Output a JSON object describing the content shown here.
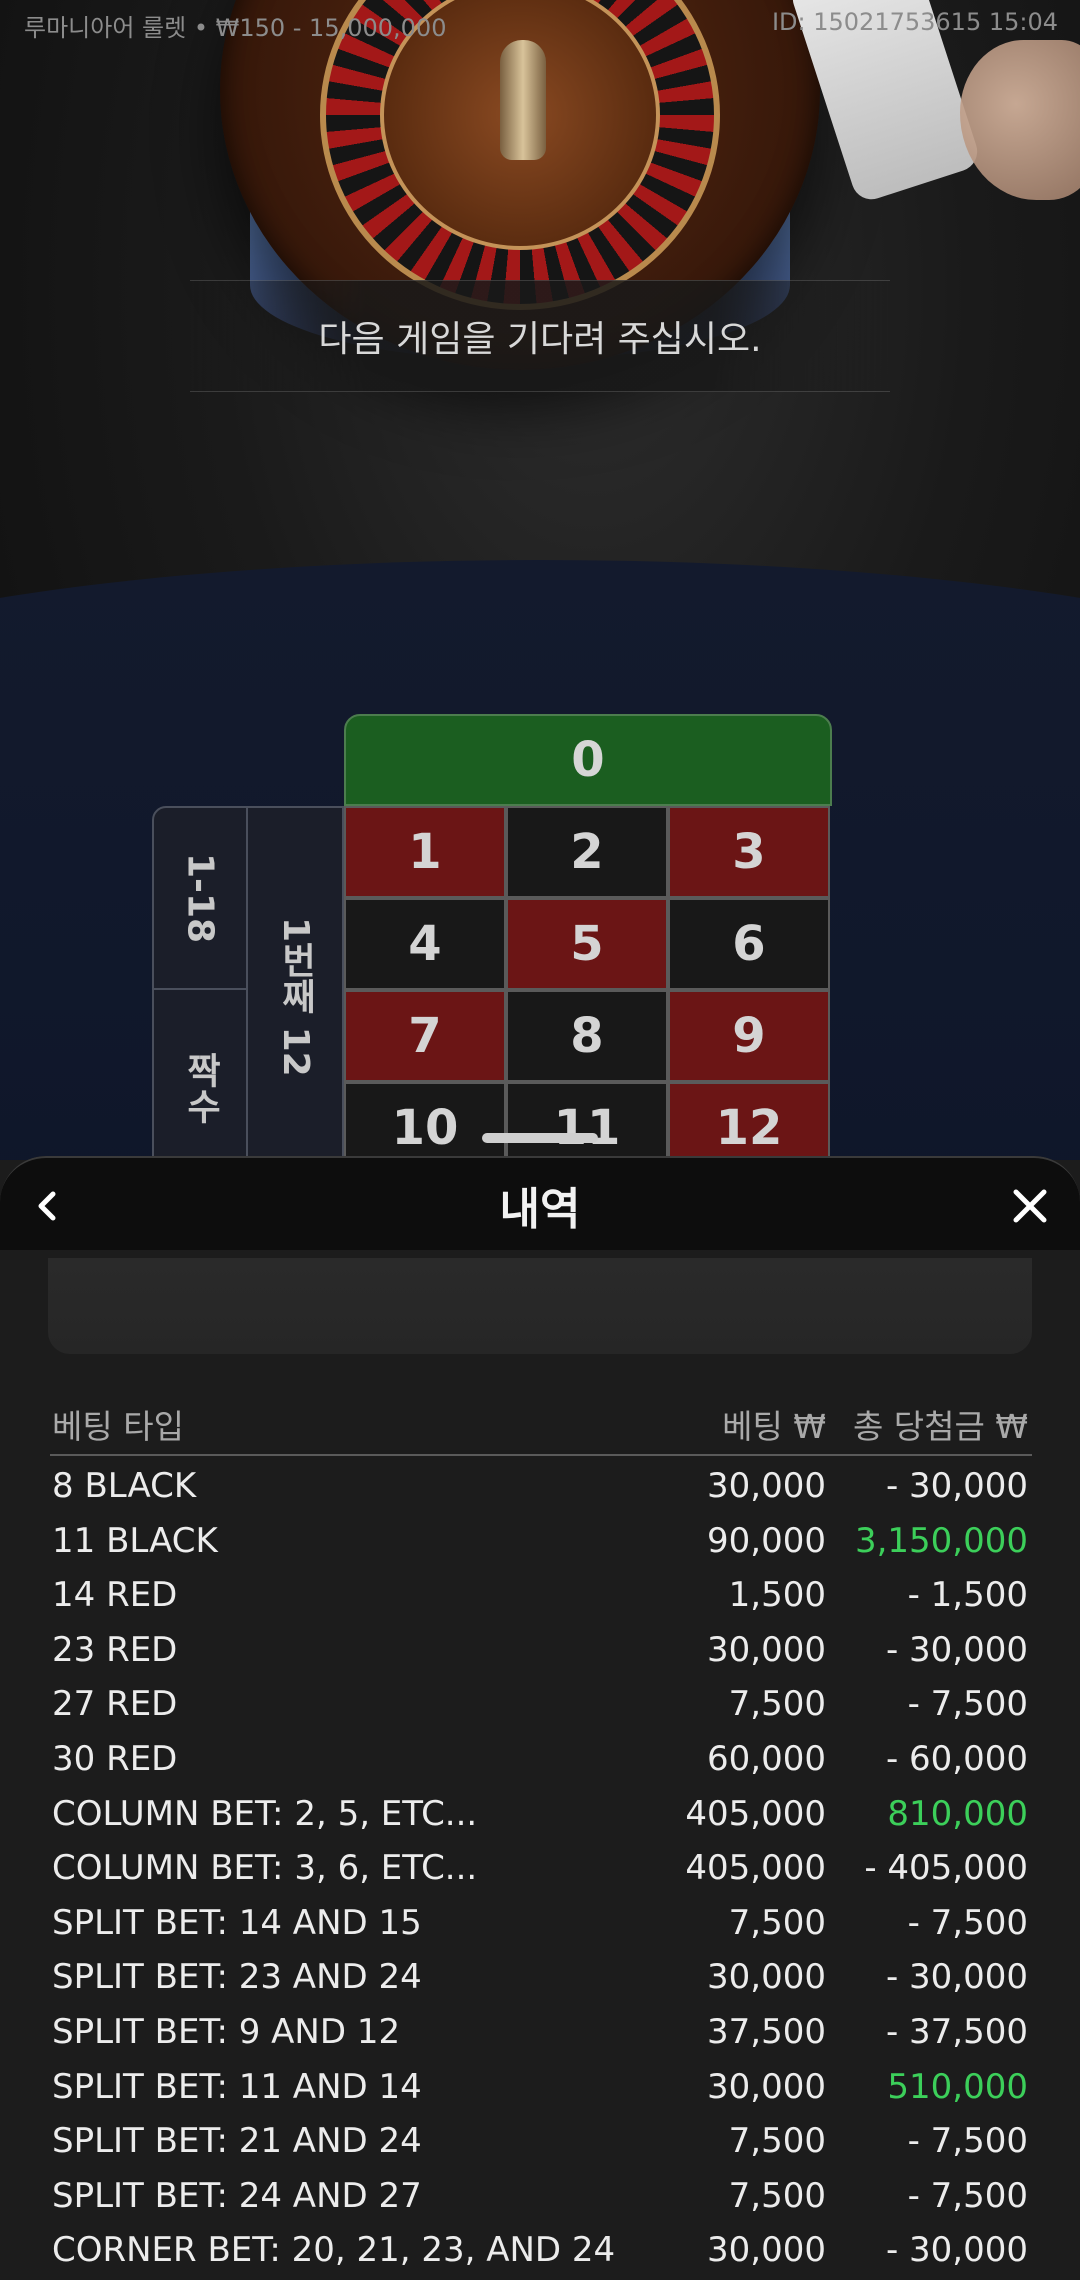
{
  "header": {
    "table_info": "루마니아어 룰렛 • ₩150 - 15,000,000",
    "game_id": "ID: 15021753615 15:04"
  },
  "status_banner": "다음 게임을 기다려 주십시오.",
  "bet_grid": {
    "zero": "0",
    "side_outer": [
      "1-18",
      "짝수"
    ],
    "side_inner": "1번째 12",
    "numbers": [
      {
        "n": "1",
        "color": "red"
      },
      {
        "n": "2",
        "color": "black"
      },
      {
        "n": "3",
        "color": "red"
      },
      {
        "n": "4",
        "color": "black"
      },
      {
        "n": "5",
        "color": "red"
      },
      {
        "n": "6",
        "color": "black"
      },
      {
        "n": "7",
        "color": "red"
      },
      {
        "n": "8",
        "color": "black"
      },
      {
        "n": "9",
        "color": "red"
      },
      {
        "n": "10",
        "color": "black"
      },
      {
        "n": "11",
        "color": "black"
      },
      {
        "n": "12",
        "color": "red"
      }
    ]
  },
  "panel": {
    "title": "내역",
    "back_icon": "chevron-left-icon",
    "close_icon": "close-icon",
    "columns": {
      "bet_type": "베팅 타입",
      "bet": "베팅 ₩",
      "total_win": "총 당첨금 ₩"
    },
    "rows": [
      {
        "type": "8 BLACK",
        "bet": "30,000",
        "win": "- 30,000",
        "positive": false
      },
      {
        "type": "11 BLACK",
        "bet": "90,000",
        "win": "3,150,000",
        "positive": true
      },
      {
        "type": "14 RED",
        "bet": "1,500",
        "win": "- 1,500",
        "positive": false
      },
      {
        "type": "23 RED",
        "bet": "30,000",
        "win": "- 30,000",
        "positive": false
      },
      {
        "type": "27 RED",
        "bet": "7,500",
        "win": "- 7,500",
        "positive": false
      },
      {
        "type": "30 RED",
        "bet": "60,000",
        "win": "- 60,000",
        "positive": false
      },
      {
        "type": "COLUMN BET: 2, 5, ETC...",
        "bet": "405,000",
        "win": "810,000",
        "positive": true
      },
      {
        "type": "COLUMN BET: 3, 6, ETC...",
        "bet": "405,000",
        "win": "- 405,000",
        "positive": false
      },
      {
        "type": "SPLIT BET: 14 AND 15",
        "bet": "7,500",
        "win": "- 7,500",
        "positive": false
      },
      {
        "type": "SPLIT BET: 23 AND 24",
        "bet": "30,000",
        "win": "- 30,000",
        "positive": false
      },
      {
        "type": "SPLIT BET: 9 AND 12",
        "bet": "37,500",
        "win": "- 37,500",
        "positive": false
      },
      {
        "type": "SPLIT BET: 11 AND 14",
        "bet": "30,000",
        "win": "510,000",
        "positive": true
      },
      {
        "type": "SPLIT BET: 21 AND 24",
        "bet": "7,500",
        "win": "- 7,500",
        "positive": false
      },
      {
        "type": "SPLIT BET: 24 AND 27",
        "bet": "7,500",
        "win": "- 7,500",
        "positive": false
      },
      {
        "type": "CORNER BET: 20, 21, 23, AND 24",
        "bet": "30,000",
        "win": "- 30,000",
        "positive": false
      }
    ]
  },
  "colors": {
    "win_positive": "#3ccf5a",
    "zero_green": "#1b5e20",
    "red_cell": "#6b1515",
    "black_cell": "#181818"
  }
}
